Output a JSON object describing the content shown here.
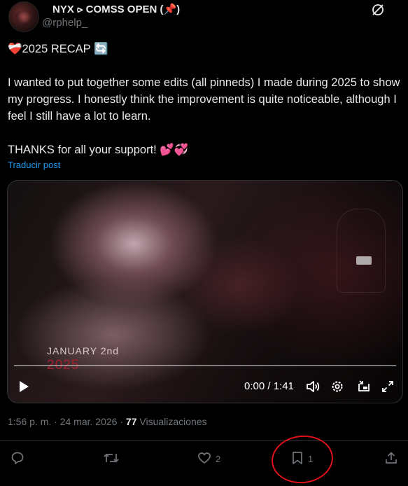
{
  "post": {
    "author": {
      "display_name": "NYX ⪧ COMSS OPEN (📌)",
      "handle": "@rphelp_"
    },
    "text_lines": [
      "❤️‍🩹2025 RECAP 🔄",
      "",
      "I wanted to put together some edits (all pinneds) I made during 2025 to show my progress. I honestly think the improvement is quite noticeable, although I feel I still have a lot to learn.",
      "",
      "THANKS for all your support! 💕💞"
    ],
    "translate_label": "Traducir post",
    "media": {
      "overlay_date": "JANUARY 2nd",
      "overlay_year": "2025",
      "time_display": "0:00 / 1:41",
      "progress_fraction": 0.0
    },
    "meta": {
      "time": "1:56 p. m.",
      "separator": "·",
      "date": "24 mar. 2026",
      "views_count": "77",
      "views_label": "Visualizaciones"
    },
    "actions": {
      "like_count": "2",
      "bookmark_count": "1"
    }
  },
  "icons": [
    "grok-icon",
    "play-icon",
    "volume-icon",
    "settings-icon",
    "pip-icon",
    "fullscreen-icon",
    "reply-icon",
    "retweet-icon",
    "like-icon",
    "bookmark-icon",
    "share-icon"
  ],
  "colors": {
    "background": "#000000",
    "text": "#e7e9ea",
    "muted": "#71767b",
    "link": "#1d9bf0",
    "annotation": "#e0101b"
  }
}
